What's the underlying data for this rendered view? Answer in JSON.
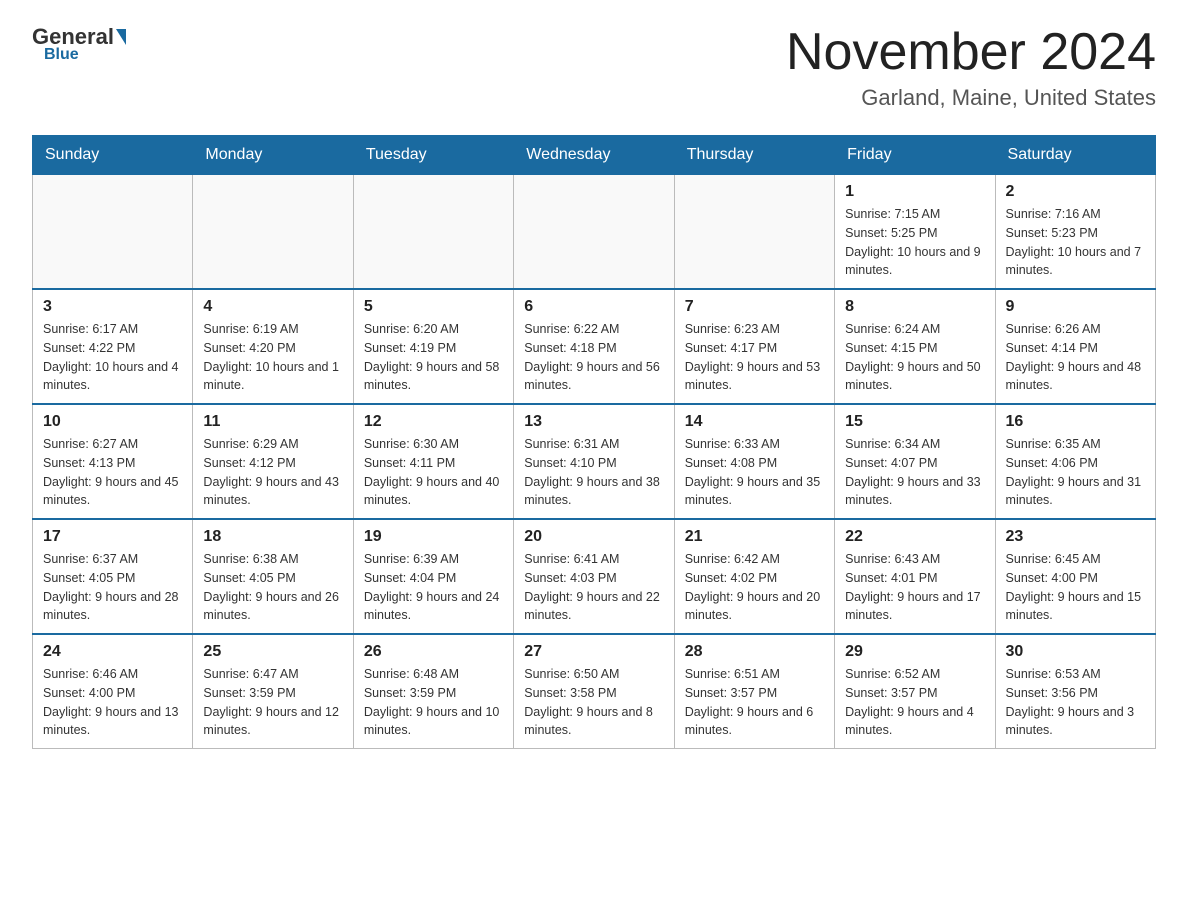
{
  "header": {
    "logo_general": "General",
    "logo_blue": "Blue",
    "month_title": "November 2024",
    "location": "Garland, Maine, United States"
  },
  "days_of_week": [
    "Sunday",
    "Monday",
    "Tuesday",
    "Wednesday",
    "Thursday",
    "Friday",
    "Saturday"
  ],
  "weeks": [
    [
      {
        "day": "",
        "info": ""
      },
      {
        "day": "",
        "info": ""
      },
      {
        "day": "",
        "info": ""
      },
      {
        "day": "",
        "info": ""
      },
      {
        "day": "",
        "info": ""
      },
      {
        "day": "1",
        "info": "Sunrise: 7:15 AM\nSunset: 5:25 PM\nDaylight: 10 hours and 9 minutes."
      },
      {
        "day": "2",
        "info": "Sunrise: 7:16 AM\nSunset: 5:23 PM\nDaylight: 10 hours and 7 minutes."
      }
    ],
    [
      {
        "day": "3",
        "info": "Sunrise: 6:17 AM\nSunset: 4:22 PM\nDaylight: 10 hours and 4 minutes."
      },
      {
        "day": "4",
        "info": "Sunrise: 6:19 AM\nSunset: 4:20 PM\nDaylight: 10 hours and 1 minute."
      },
      {
        "day": "5",
        "info": "Sunrise: 6:20 AM\nSunset: 4:19 PM\nDaylight: 9 hours and 58 minutes."
      },
      {
        "day": "6",
        "info": "Sunrise: 6:22 AM\nSunset: 4:18 PM\nDaylight: 9 hours and 56 minutes."
      },
      {
        "day": "7",
        "info": "Sunrise: 6:23 AM\nSunset: 4:17 PM\nDaylight: 9 hours and 53 minutes."
      },
      {
        "day": "8",
        "info": "Sunrise: 6:24 AM\nSunset: 4:15 PM\nDaylight: 9 hours and 50 minutes."
      },
      {
        "day": "9",
        "info": "Sunrise: 6:26 AM\nSunset: 4:14 PM\nDaylight: 9 hours and 48 minutes."
      }
    ],
    [
      {
        "day": "10",
        "info": "Sunrise: 6:27 AM\nSunset: 4:13 PM\nDaylight: 9 hours and 45 minutes."
      },
      {
        "day": "11",
        "info": "Sunrise: 6:29 AM\nSunset: 4:12 PM\nDaylight: 9 hours and 43 minutes."
      },
      {
        "day": "12",
        "info": "Sunrise: 6:30 AM\nSunset: 4:11 PM\nDaylight: 9 hours and 40 minutes."
      },
      {
        "day": "13",
        "info": "Sunrise: 6:31 AM\nSunset: 4:10 PM\nDaylight: 9 hours and 38 minutes."
      },
      {
        "day": "14",
        "info": "Sunrise: 6:33 AM\nSunset: 4:08 PM\nDaylight: 9 hours and 35 minutes."
      },
      {
        "day": "15",
        "info": "Sunrise: 6:34 AM\nSunset: 4:07 PM\nDaylight: 9 hours and 33 minutes."
      },
      {
        "day": "16",
        "info": "Sunrise: 6:35 AM\nSunset: 4:06 PM\nDaylight: 9 hours and 31 minutes."
      }
    ],
    [
      {
        "day": "17",
        "info": "Sunrise: 6:37 AM\nSunset: 4:05 PM\nDaylight: 9 hours and 28 minutes."
      },
      {
        "day": "18",
        "info": "Sunrise: 6:38 AM\nSunset: 4:05 PM\nDaylight: 9 hours and 26 minutes."
      },
      {
        "day": "19",
        "info": "Sunrise: 6:39 AM\nSunset: 4:04 PM\nDaylight: 9 hours and 24 minutes."
      },
      {
        "day": "20",
        "info": "Sunrise: 6:41 AM\nSunset: 4:03 PM\nDaylight: 9 hours and 22 minutes."
      },
      {
        "day": "21",
        "info": "Sunrise: 6:42 AM\nSunset: 4:02 PM\nDaylight: 9 hours and 20 minutes."
      },
      {
        "day": "22",
        "info": "Sunrise: 6:43 AM\nSunset: 4:01 PM\nDaylight: 9 hours and 17 minutes."
      },
      {
        "day": "23",
        "info": "Sunrise: 6:45 AM\nSunset: 4:00 PM\nDaylight: 9 hours and 15 minutes."
      }
    ],
    [
      {
        "day": "24",
        "info": "Sunrise: 6:46 AM\nSunset: 4:00 PM\nDaylight: 9 hours and 13 minutes."
      },
      {
        "day": "25",
        "info": "Sunrise: 6:47 AM\nSunset: 3:59 PM\nDaylight: 9 hours and 12 minutes."
      },
      {
        "day": "26",
        "info": "Sunrise: 6:48 AM\nSunset: 3:59 PM\nDaylight: 9 hours and 10 minutes."
      },
      {
        "day": "27",
        "info": "Sunrise: 6:50 AM\nSunset: 3:58 PM\nDaylight: 9 hours and 8 minutes."
      },
      {
        "day": "28",
        "info": "Sunrise: 6:51 AM\nSunset: 3:57 PM\nDaylight: 9 hours and 6 minutes."
      },
      {
        "day": "29",
        "info": "Sunrise: 6:52 AM\nSunset: 3:57 PM\nDaylight: 9 hours and 4 minutes."
      },
      {
        "day": "30",
        "info": "Sunrise: 6:53 AM\nSunset: 3:56 PM\nDaylight: 9 hours and 3 minutes."
      }
    ]
  ]
}
